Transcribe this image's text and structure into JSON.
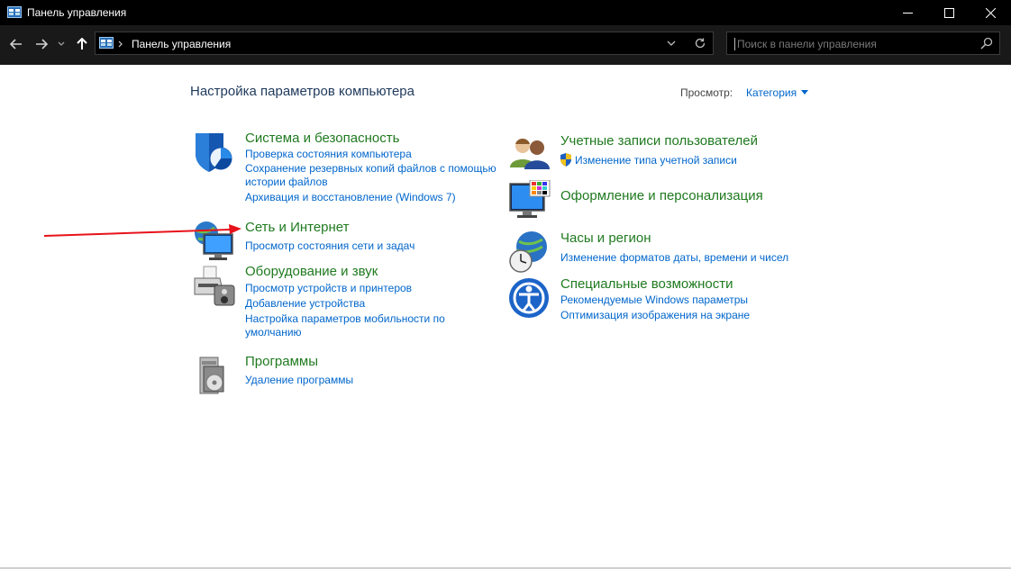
{
  "window": {
    "title": "Панель управления"
  },
  "nav": {
    "breadcrumb": "Панель управления",
    "search_placeholder": "Поиск в панели управления"
  },
  "content": {
    "title": "Настройка параметров компьютера",
    "view_label": "Просмотр:",
    "view_value": "Категория"
  },
  "categories": [
    {
      "title": "Система и безопасность",
      "icon": "shield-icon",
      "links": [
        "Проверка состояния компьютера",
        "Сохранение резервных копий файлов с помощью",
        "истории файлов",
        "Архивация и восстановление (Windows 7)"
      ]
    },
    {
      "title": "Сеть и Интернет",
      "icon": "network-icon",
      "links": [
        "Просмотр состояния сети и задач"
      ]
    },
    {
      "title": "Оборудование и звук",
      "icon": "printer-icon",
      "links": [
        "Просмотр устройств и принтеров",
        "Добавление устройства",
        "Настройка параметров мобильности по",
        "умолчанию"
      ]
    },
    {
      "title": "Программы",
      "icon": "programs-icon",
      "links": [
        "Удаление программы"
      ]
    },
    {
      "title": "Учетные записи пользователей",
      "icon": "users-icon",
      "links": [
        "Изменение типа учетной записи"
      ]
    },
    {
      "title": "Оформление и персонализация",
      "icon": "monitor-palette-icon",
      "links": []
    },
    {
      "title": "Часы и регион",
      "icon": "clock-globe-icon",
      "links": [
        "Изменение форматов даты, времени и чисел"
      ]
    },
    {
      "title": "Специальные возможности",
      "icon": "accessibility-icon",
      "links": [
        "Рекомендуемые Windows параметры",
        "Оптимизация изображения на экране"
      ]
    }
  ],
  "colors": {
    "heading_green": "#1f7a1f",
    "link_blue": "#0066cc",
    "annotation_arrow": "#e8121a"
  }
}
